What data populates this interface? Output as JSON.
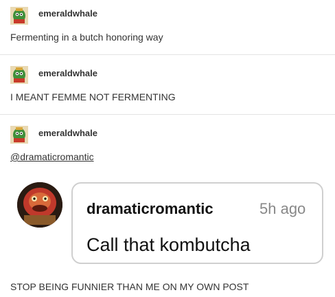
{
  "posts": [
    {
      "username": "emeraldwhale",
      "text": "Fermenting in a butch honoring way"
    },
    {
      "username": "emeraldwhale",
      "text": "I MEANT FEMME NOT FERMENTING"
    },
    {
      "username": "emeraldwhale",
      "text": "@dramaticromantic"
    }
  ],
  "reply": {
    "username": "dramaticromantic",
    "time": "5h ago",
    "text": "Call that kombutcha"
  },
  "footer": {
    "text": "STOP BEING FUNNIER THAN ME ON MY OWN POST"
  },
  "icons": {
    "small_avatar": "green-creature-avatar-icon",
    "reply_avatar": "red-muppet-avatar-icon"
  }
}
